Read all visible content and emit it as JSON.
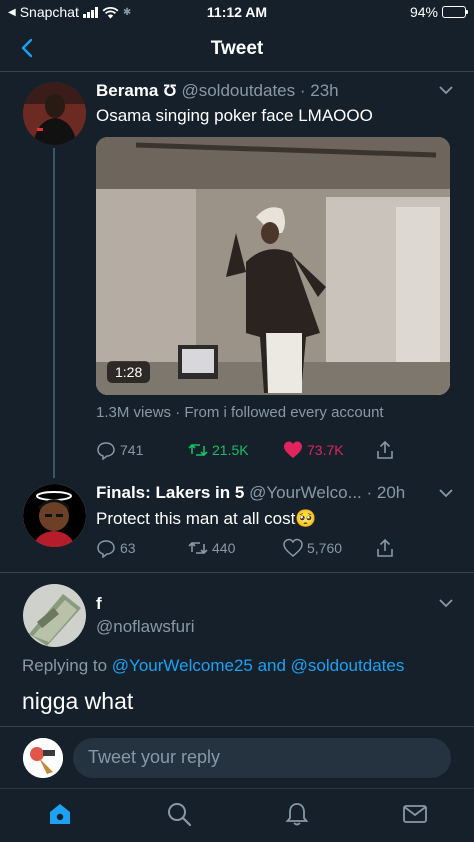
{
  "status_bar": {
    "back_app": "Snapchat",
    "time": "11:12 AM",
    "battery": "94%",
    "battery_level": 0.94
  },
  "header": {
    "title": "Tweet"
  },
  "tweet": {
    "name": "Berama Ʊ",
    "handle": "@soldoutdates",
    "time": "23h",
    "text": "Osama singing poker face LMAOOO",
    "video_duration": "1:28",
    "views_line": "1.3M views · From i followed every account",
    "replies": "741",
    "retweets": "21.5K",
    "likes": "73.7K",
    "retweet_color": "#17bf63",
    "like_color": "#e0245e"
  },
  "reply1": {
    "name": "Finals: Lakers in 5",
    "handle": "@YourWelco...",
    "time": "20h",
    "text": "Protect this man at all cost",
    "emoji": "🥺",
    "replies": "63",
    "retweets": "440",
    "likes": "5,760"
  },
  "reply2": {
    "name": "f",
    "handle": "@noflawsfuri",
    "replying_prefix": "Replying to",
    "replying_to": "@YourWelcome25 and @soldoutdates",
    "text": "nigga what"
  },
  "composer": {
    "placeholder": "Tweet your reply"
  },
  "nav": {
    "items": [
      "home-icon",
      "search-icon",
      "notifications-icon",
      "messages-icon"
    ],
    "accent": "#1da1f2"
  }
}
